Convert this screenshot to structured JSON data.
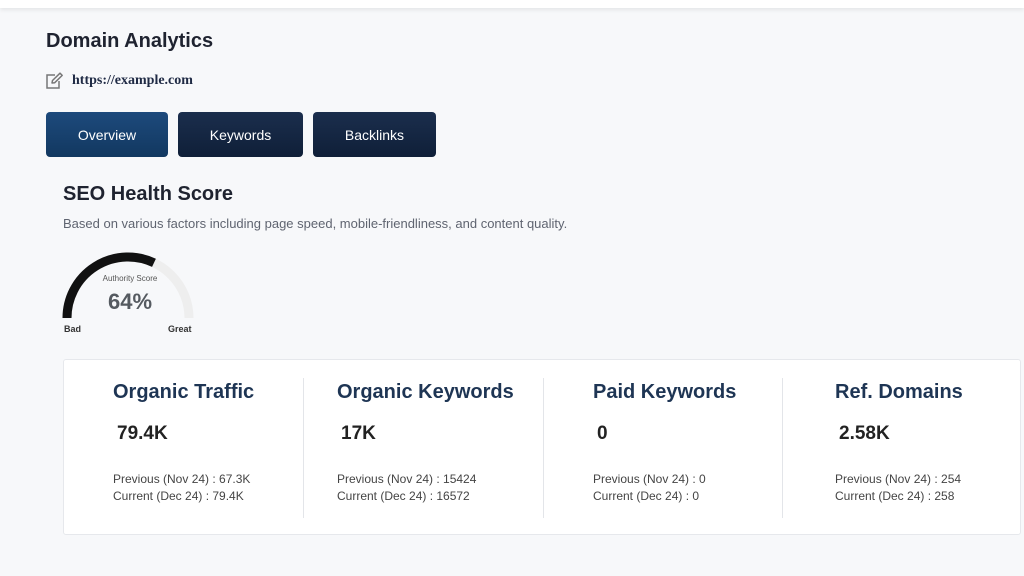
{
  "header": {
    "title": "Domain Analytics",
    "edit_icon": "edit-icon",
    "domain": "https://example.com"
  },
  "tabs": [
    {
      "label": "Overview",
      "active": true
    },
    {
      "label": "Keywords",
      "active": false
    },
    {
      "label": "Backlinks",
      "active": false
    }
  ],
  "seo": {
    "title": "SEO Health Score",
    "subtitle": "Based on various factors including page speed, mobile-friendliness, and content quality.",
    "gauge": {
      "label": "Authority Score",
      "value_text": "64%",
      "value": 0.64,
      "min_label": "Bad",
      "max_label": "Great"
    }
  },
  "stats": [
    {
      "title": "Organic Traffic",
      "value": "79.4K",
      "previous": "Previous (Nov 24) : 67.3K",
      "current": "Current (Dec 24) : 79.4K"
    },
    {
      "title": "Organic Keywords",
      "value": "17K",
      "previous": "Previous (Nov 24) : 15424",
      "current": "Current (Dec 24) : 16572"
    },
    {
      "title": "Paid Keywords",
      "value": "0",
      "previous": "Previous (Nov 24) : 0",
      "current": "Current (Dec 24) : 0"
    },
    {
      "title": "Ref. Domains",
      "value": "2.58K",
      "previous": "Previous (Nov 24) : 254",
      "current": "Current (Dec 24) : 258"
    }
  ],
  "colors": {
    "tab_bg": "#0f1f38",
    "tab_active_bg": "#123860",
    "stat_title": "#1e3554",
    "gauge_fill": "#111111",
    "gauge_track": "#eeeeee"
  }
}
